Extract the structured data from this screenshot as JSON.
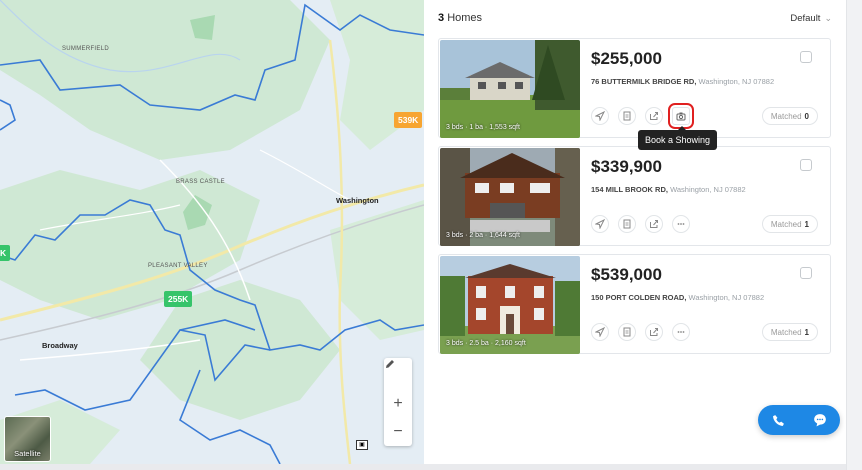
{
  "map": {
    "area_labels": {
      "summerfield": "SUMMERFIELD",
      "brass_castle": "BRASS CASTLE",
      "pleasant_valley": "PLEASANT VALLEY"
    },
    "towns": {
      "washington": "Washington",
      "broadway": "Broadway"
    },
    "pins": [
      {
        "label": "539K",
        "color": "#f7a531"
      },
      {
        "label": "255K",
        "color": "#36c46a"
      },
      {
        "label": "K",
        "color": "#36c46a"
      }
    ],
    "satellite_label": "Satellite",
    "colors": {
      "forest": "#cfe8d4",
      "water_bg": "#e4edf4",
      "boundary": "#3a7bd5",
      "road": "#f2e9a8"
    }
  },
  "list": {
    "count": "3",
    "count_suffix": "Homes",
    "sort": "Default"
  },
  "tooltip": "Book a Showing",
  "homes": [
    {
      "price": "$255,000",
      "street": "76 BUTTERMILK BRIDGE RD,",
      "city": "Washington, NJ 07882",
      "caption": "3 bds · 1 ba · 1,553 sqft",
      "matched_label": "Matched",
      "matched_count": "0"
    },
    {
      "price": "$339,900",
      "street": "154 MILL BROOK RD,",
      "city": "Washington, NJ 07882",
      "caption": "3 bds · 2 ba · 1,644 sqft",
      "matched_label": "Matched",
      "matched_count": "1"
    },
    {
      "price": "$539,000",
      "street": "150 PORT COLDEN ROAD,",
      "city": "Washington, NJ 07882",
      "caption": "3 bds · 2.5 ba · 2,160 sqft",
      "matched_label": "Matched",
      "matched_count": "1"
    }
  ],
  "accent": "#1e88e5",
  "highlight_color": "#e02020"
}
